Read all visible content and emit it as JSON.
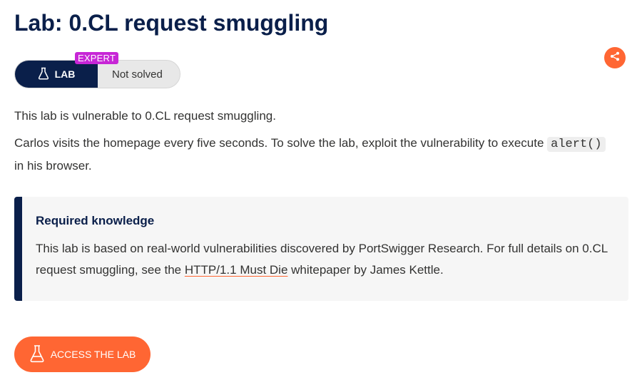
{
  "page": {
    "title": "Lab: 0.CL request smuggling"
  },
  "status": {
    "lab_label": "LAB",
    "level_badge": "EXPERT",
    "state": "Not solved"
  },
  "icons": {
    "lab": "flask-icon",
    "share": "share-icon",
    "access": "flask-icon"
  },
  "description": {
    "p1": "This lab is vulnerable to 0.CL request smuggling.",
    "p2_before": "Carlos visits the homepage every five seconds. To solve the lab, exploit the vulnerability to execute",
    "p2_code": "alert()",
    "p2_after": "in his browser."
  },
  "callout": {
    "heading": "Required knowledge",
    "body_before": "This lab is based on real-world vulnerabilities discovered by PortSwigger Research. For full details on 0.CL request smuggling, see the",
    "link_text": "HTTP/1.1 Must Die",
    "body_after": "whitepaper by James Kettle."
  },
  "actions": {
    "access_label": "ACCESS THE LAB"
  },
  "colors": {
    "navy": "#0a1f4a",
    "orange": "#ff6633",
    "expert_purple": "#c726d6"
  }
}
